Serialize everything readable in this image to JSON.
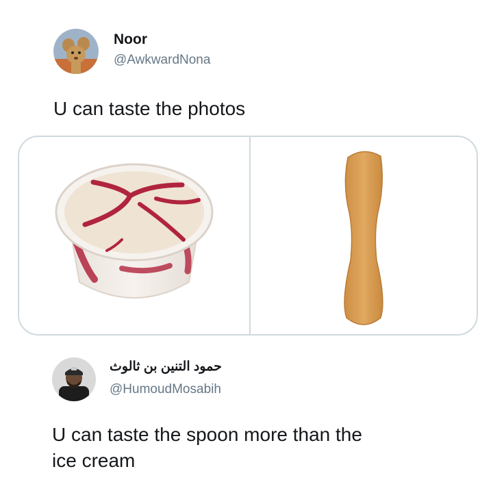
{
  "tweets": [
    {
      "display_name": "Noor",
      "handle": "@AwkwardNona",
      "text": "U can taste the photos",
      "media": [
        {
          "icon": "ice-cream-cup-photo"
        },
        {
          "icon": "wooden-spoon-photo"
        }
      ]
    },
    {
      "display_name": "حمود التنين بن ثالوث",
      "handle": "@HumoudMosabih",
      "text_lines": [
        "U can taste the spoon more than the",
        "ice cream"
      ]
    }
  ],
  "colors": {
    "name": "#14171a",
    "handle": "#657786",
    "border": "#cfd9de"
  }
}
